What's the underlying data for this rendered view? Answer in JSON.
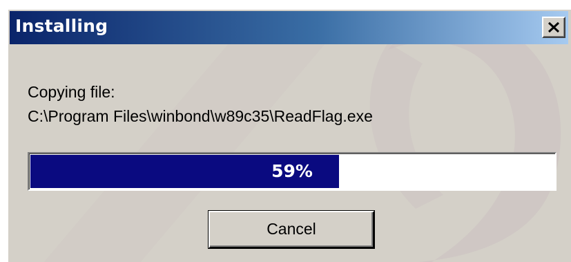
{
  "window": {
    "title": "Installing",
    "close_icon": "close-x-icon"
  },
  "status": {
    "action_label": "Copying file:",
    "file_path": "C:\\Program Files\\winbond\\w89c35\\ReadFlag.exe"
  },
  "progress": {
    "percent": 59,
    "label": "59%",
    "fill_color": "#0a0a80"
  },
  "buttons": {
    "cancel_label": "Cancel"
  },
  "colors": {
    "title_gradient_start": "#0a246a",
    "title_gradient_end": "#a6caf0",
    "dialog_face": "#d4d0c8"
  }
}
